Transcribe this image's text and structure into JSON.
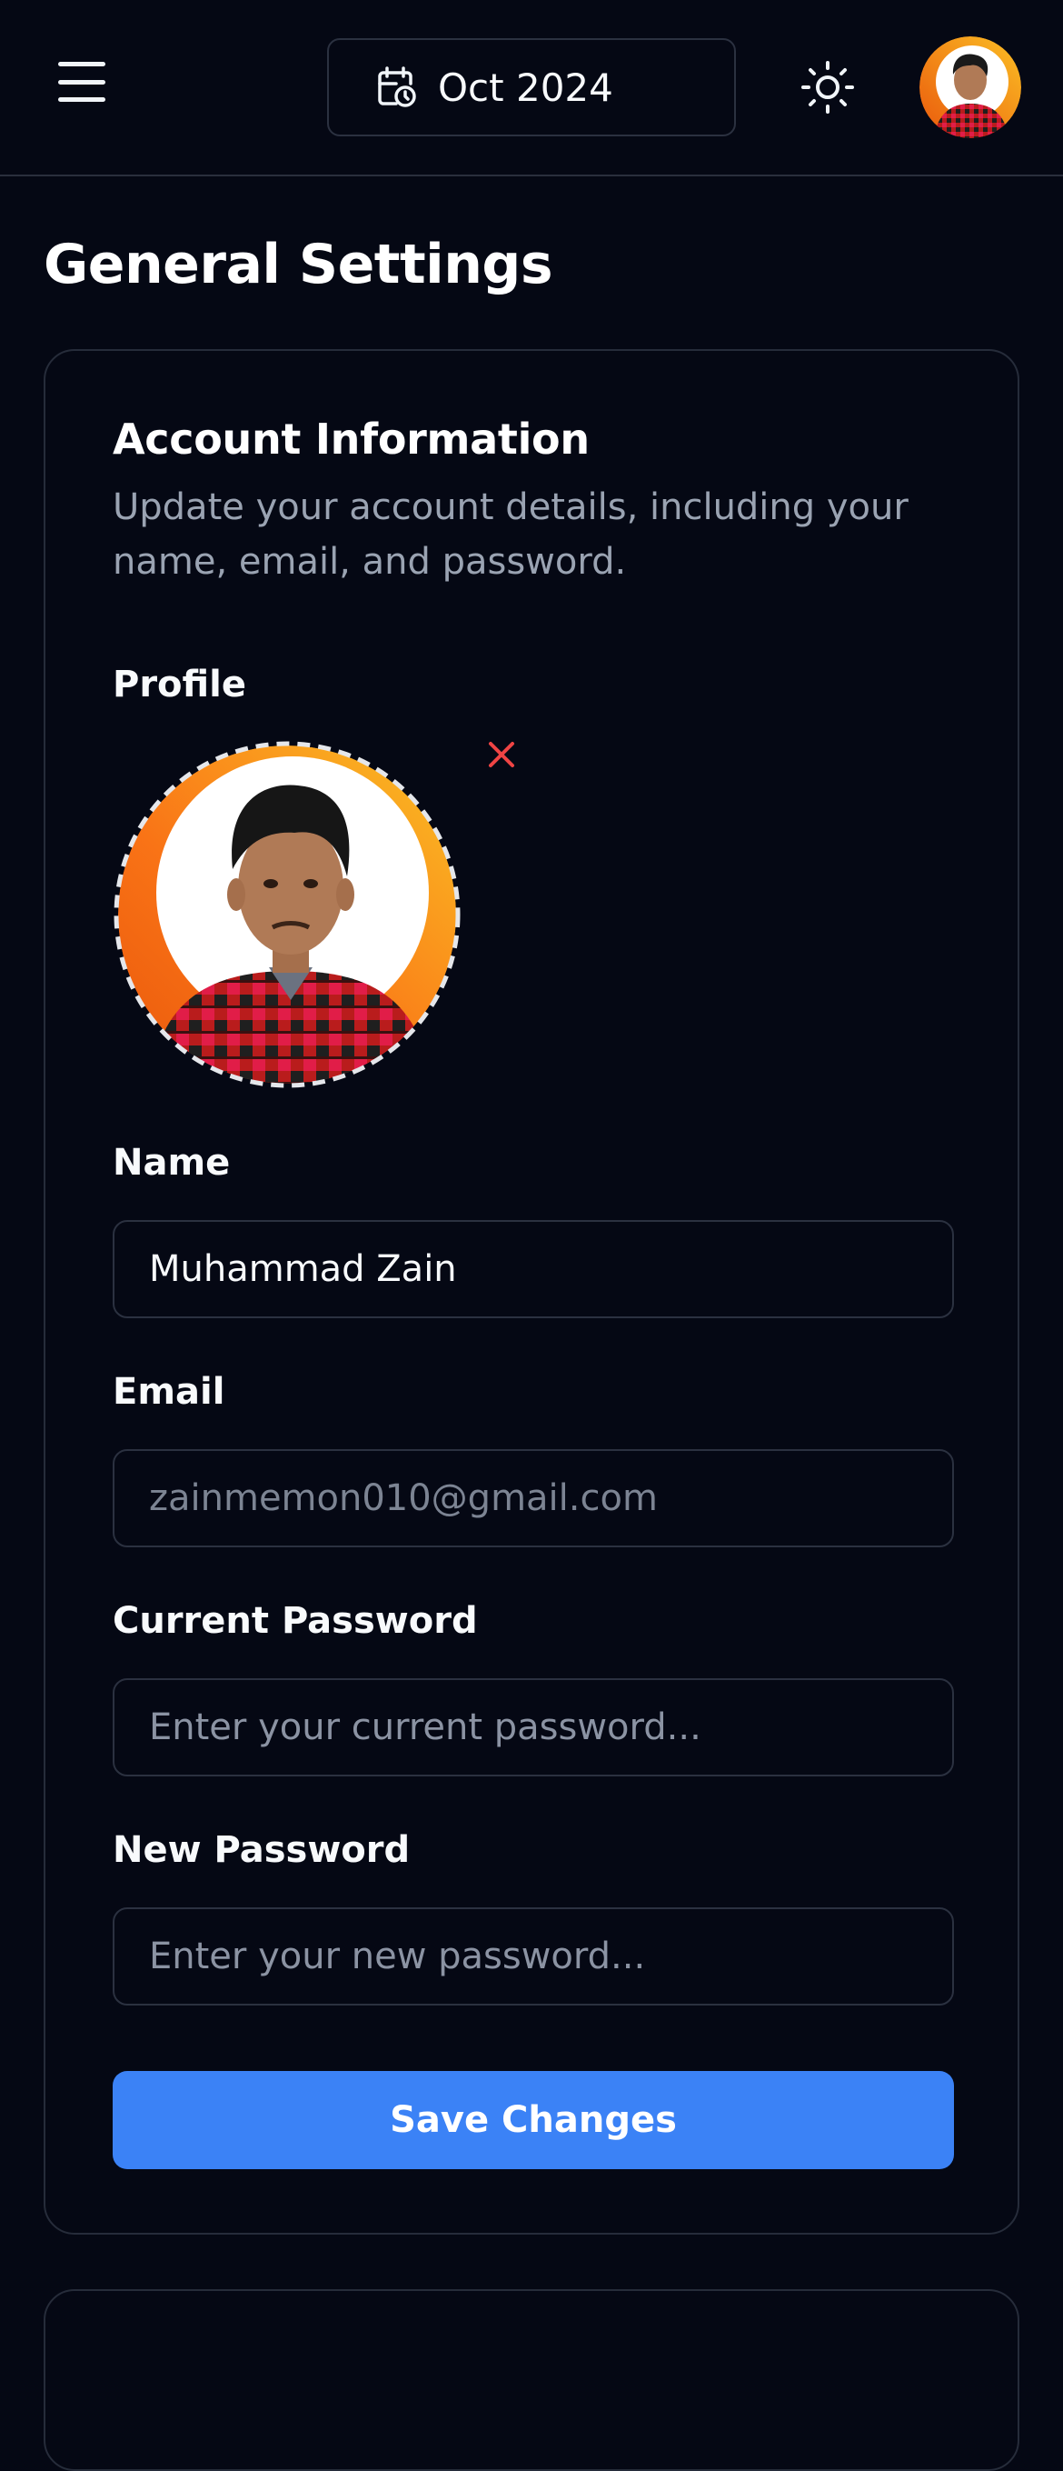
{
  "header": {
    "menu_icon": "hamburger-menu-icon",
    "date_icon": "calendar-clock-icon",
    "date_label": "Oct 2024",
    "theme_icon": "sun-icon",
    "avatar_alt": "user-avatar"
  },
  "page": {
    "title": "General Settings"
  },
  "account": {
    "title": "Account Information",
    "description": "Update your account details, including your name, email, and password.",
    "profile_label": "Profile",
    "remove_icon": "close-icon",
    "name_label": "Name",
    "name_value": "Muhammad Zain",
    "email_label": "Email",
    "email_value": "zainmemon010@gmail.com",
    "current_password_label": "Current Password",
    "current_password_placeholder": "Enter your current password...",
    "new_password_label": "New Password",
    "new_password_placeholder": "Enter your new password...",
    "save_label": "Save Changes"
  },
  "colors": {
    "background": "#050814",
    "accent": "#3b82f6",
    "remove": "#ef4444",
    "muted_text": "#9aa3b2",
    "border": "#2b3140"
  }
}
